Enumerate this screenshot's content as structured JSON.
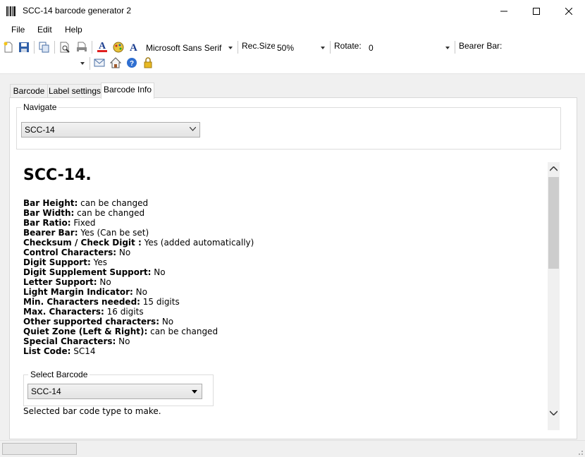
{
  "window": {
    "title": "SCC-14 barcode generator 2"
  },
  "menu": [
    "File",
    "Edit",
    "Help"
  ],
  "toolbar": {
    "font_name": "Microsoft Sans Serif",
    "recsize_label": "Rec.Size",
    "recsize_value": "50%",
    "rotate_label": "Rotate:",
    "rotate_value": "0",
    "bearer_label": "Bearer Bar:",
    "accent": "#e02020"
  },
  "tabs": [
    {
      "label": "Barcode",
      "active": false
    },
    {
      "label": "Label settings",
      "active": false
    },
    {
      "label": "Barcode Info",
      "active": true
    }
  ],
  "navigate": {
    "legend": "Navigate",
    "value": "SCC-14"
  },
  "info": {
    "heading": "SCC-14.",
    "properties": [
      {
        "name": "Bar Height:",
        "value": " can be changed"
      },
      {
        "name": "Bar Width:",
        "value": " can be changed"
      },
      {
        "name": "Bar Ratio:",
        "value": " Fixed"
      },
      {
        "name": "Bearer Bar:",
        "value": " Yes (Can be set)"
      },
      {
        "name": "Checksum / Check Digit :",
        "value": " Yes (added automatically)"
      },
      {
        "name": "Control Characters:",
        "value": " No"
      },
      {
        "name": "Digit Support:",
        "value": " Yes"
      },
      {
        "name": "Digit Supplement Support:",
        "value": " No"
      },
      {
        "name": "Letter Support:",
        "value": " No"
      },
      {
        "name": "Light Margin Indicator:",
        "value": " No"
      },
      {
        "name": "Min. Characters needed:",
        "value": " 15 digits"
      },
      {
        "name": "Max. Characters:",
        "value": " 16 digits"
      },
      {
        "name": "Other supported characters:",
        "value": " No"
      },
      {
        "name": "Quiet Zone (Left & Right):",
        "value": " can be changed"
      },
      {
        "name": "Special Characters:",
        "value": " No"
      },
      {
        "name": "List Code:",
        "value": " SC14"
      }
    ],
    "select_legend": "Select Barcode",
    "select_value": "SCC-14",
    "select_caption": "Selected bar code type to make."
  }
}
